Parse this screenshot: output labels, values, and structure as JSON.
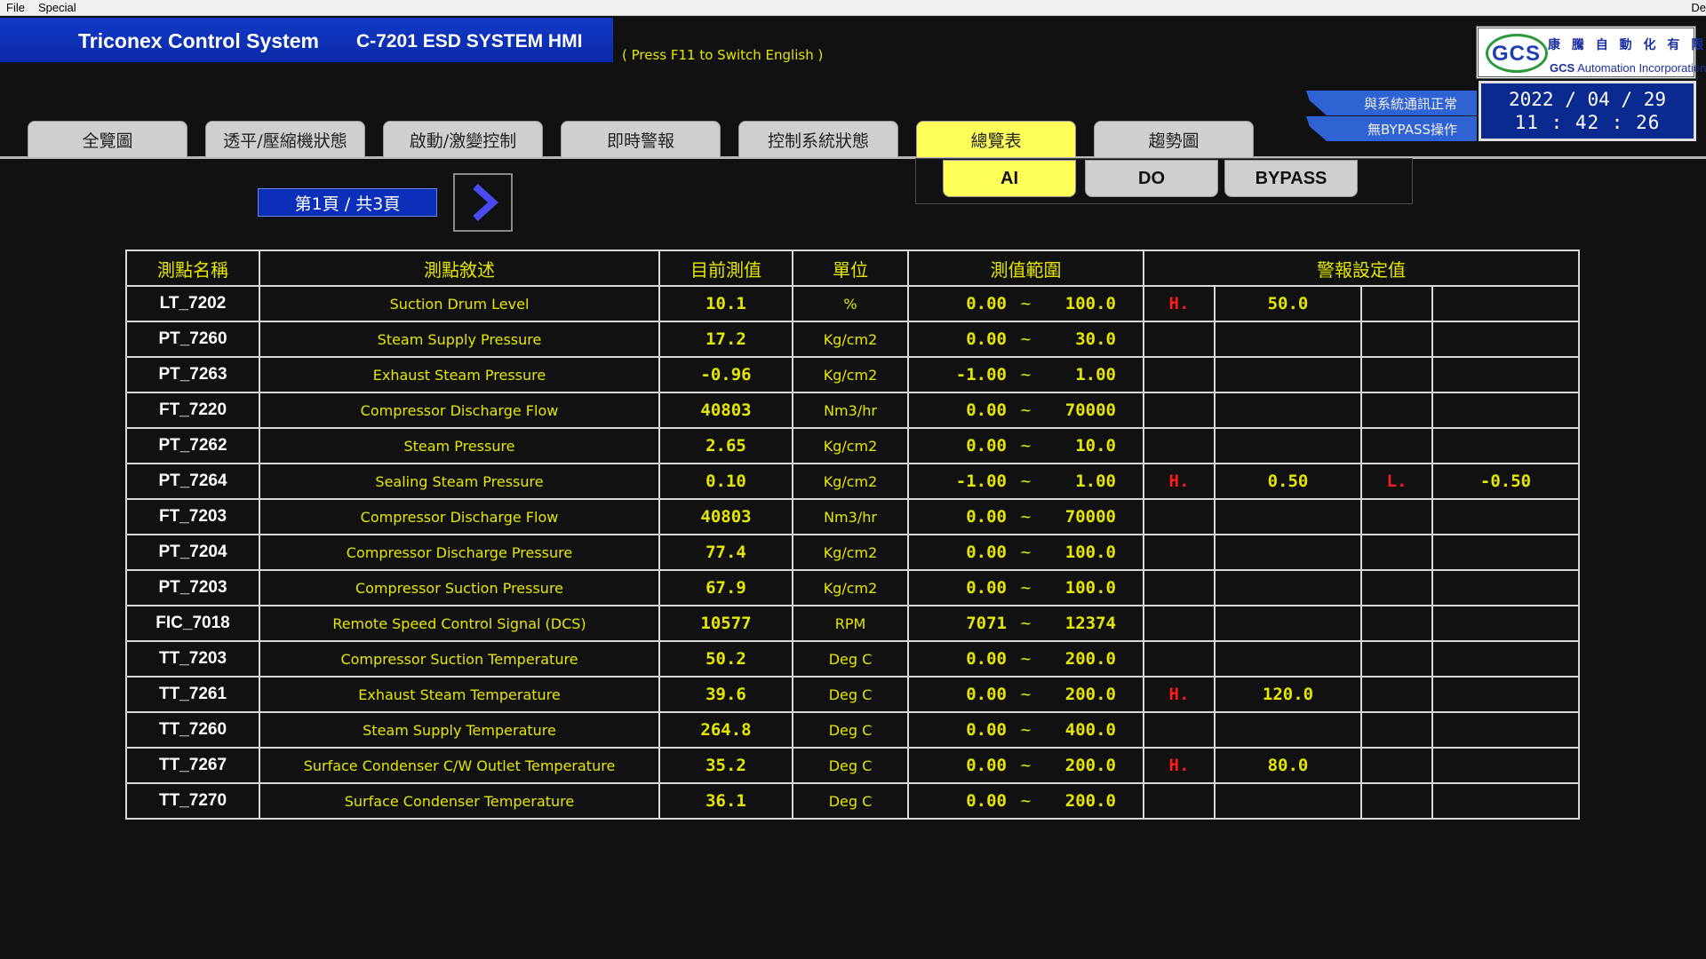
{
  "menu": {
    "items": [
      "File",
      "Special"
    ],
    "edge_text": "De"
  },
  "header": {
    "system_name": "Triconex Control System",
    "hmi_title": "C-7201 ESD SYSTEM HMI",
    "language_hint": "( Press F11 to Switch English )"
  },
  "logo": {
    "mark": "GCS",
    "company_cn": "康 騰 自 動 化 有 限 公 司",
    "company_en_bold": "GCS",
    "company_en": " Automation Incorporation"
  },
  "status": {
    "comm": "與系統通訊正常",
    "bypass": "無BYPASS操作"
  },
  "clock": {
    "date": "2022 / 04 / 29",
    "time": "11 : 42 : 26"
  },
  "tabs": [
    {
      "label": "全覽圖"
    },
    {
      "label": "透平/壓縮機狀態"
    },
    {
      "label": "啟動/激變控制"
    },
    {
      "label": "即時警報"
    },
    {
      "label": "控制系統狀態"
    },
    {
      "label": "總覽表"
    },
    {
      "label": "趨勢圖"
    }
  ],
  "active_tab": "總覽表",
  "subtabs": [
    {
      "label": "AI"
    },
    {
      "label": "DO"
    },
    {
      "label": "BYPASS"
    }
  ],
  "active_subtab": "AI",
  "pager": {
    "label": "第1頁 / 共3頁",
    "next_icon": "chevron-right-icon"
  },
  "table": {
    "headers": [
      "測點名稱",
      "測點敘述",
      "目前測值",
      "單位",
      "測值範圍",
      "警報設定值"
    ],
    "range_separator": "~",
    "rows": [
      {
        "tag": "LT_7202",
        "desc": "Suction Drum Level",
        "value": "10.1",
        "unit": "%",
        "lo": "0.00",
        "hi": "100.0",
        "h": "H.",
        "hv": "50.0",
        "l": "",
        "lv": ""
      },
      {
        "tag": "PT_7260",
        "desc": "Steam Supply Pressure",
        "value": "17.2",
        "unit": "Kg/cm2",
        "lo": "0.00",
        "hi": "30.0",
        "h": "",
        "hv": "",
        "l": "",
        "lv": ""
      },
      {
        "tag": "PT_7263",
        "desc": "Exhaust Steam Pressure",
        "value": "-0.96",
        "unit": "Kg/cm2",
        "lo": "-1.00",
        "hi": "1.00",
        "h": "",
        "hv": "",
        "l": "",
        "lv": ""
      },
      {
        "tag": "FT_7220",
        "desc": "Compressor Discharge Flow",
        "value": "40803",
        "unit": "Nm3/hr",
        "lo": "0.00",
        "hi": "70000",
        "h": "",
        "hv": "",
        "l": "",
        "lv": ""
      },
      {
        "tag": "PT_7262",
        "desc": "Steam Pressure",
        "value": "2.65",
        "unit": "Kg/cm2",
        "lo": "0.00",
        "hi": "10.0",
        "h": "",
        "hv": "",
        "l": "",
        "lv": ""
      },
      {
        "tag": "PT_7264",
        "desc": "Sealing Steam Pressure",
        "value": "0.10",
        "unit": "Kg/cm2",
        "lo": "-1.00",
        "hi": "1.00",
        "h": "H.",
        "hv": "0.50",
        "l": "L.",
        "lv": "-0.50"
      },
      {
        "tag": "FT_7203",
        "desc": "Compressor Discharge Flow",
        "value": "40803",
        "unit": "Nm3/hr",
        "lo": "0.00",
        "hi": "70000",
        "h": "",
        "hv": "",
        "l": "",
        "lv": ""
      },
      {
        "tag": "PT_7204",
        "desc": "Compressor Discharge Pressure",
        "value": "77.4",
        "unit": "Kg/cm2",
        "lo": "0.00",
        "hi": "100.0",
        "h": "",
        "hv": "",
        "l": "",
        "lv": ""
      },
      {
        "tag": "PT_7203",
        "desc": "Compressor Suction Pressure",
        "value": "67.9",
        "unit": "Kg/cm2",
        "lo": "0.00",
        "hi": "100.0",
        "h": "",
        "hv": "",
        "l": "",
        "lv": ""
      },
      {
        "tag": "FIC_7018",
        "desc": "Remote Speed Control Signal (DCS)",
        "value": "10577",
        "unit": "RPM",
        "lo": "7071",
        "hi": "12374",
        "h": "",
        "hv": "",
        "l": "",
        "lv": ""
      },
      {
        "tag": "TT_7203",
        "desc": "Compressor Suction Temperature",
        "value": "50.2",
        "unit": "Deg C",
        "lo": "0.00",
        "hi": "200.0",
        "h": "",
        "hv": "",
        "l": "",
        "lv": ""
      },
      {
        "tag": "TT_7261",
        "desc": "Exhaust Steam Temperature",
        "value": "39.6",
        "unit": "Deg C",
        "lo": "0.00",
        "hi": "200.0",
        "h": "H.",
        "hv": "120.0",
        "l": "",
        "lv": ""
      },
      {
        "tag": "TT_7260",
        "desc": "Steam Supply Temperature",
        "value": "264.8",
        "unit": "Deg C",
        "lo": "0.00",
        "hi": "400.0",
        "h": "",
        "hv": "",
        "l": "",
        "lv": ""
      },
      {
        "tag": "TT_7267",
        "desc": "Surface Condenser C/W Outlet Temperature",
        "value": "35.2",
        "unit": "Deg C",
        "lo": "0.00",
        "hi": "200.0",
        "h": "H.",
        "hv": "80.0",
        "l": "",
        "lv": ""
      },
      {
        "tag": "TT_7270",
        "desc": "Surface Condenser Temperature",
        "value": "36.1",
        "unit": "Deg C",
        "lo": "0.00",
        "hi": "200.0",
        "h": "",
        "hv": "",
        "l": "",
        "lv": ""
      }
    ]
  },
  "colors": {
    "background": "#111111",
    "banner_blue": "#0b2fb8",
    "text_yellow": "#e6e600",
    "alarm_red": "#ff1a1a",
    "active_tab_yellow": "#ffff5a",
    "tab_gray": "#cfcfcf"
  }
}
